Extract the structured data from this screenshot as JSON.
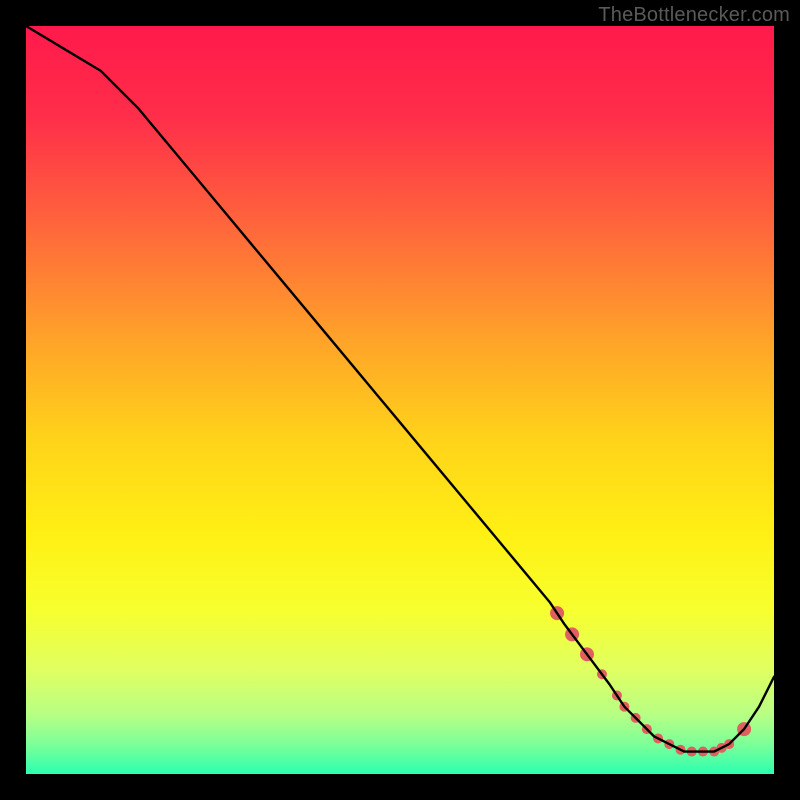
{
  "watermark": "TheBottlenecker.com",
  "chart_data": {
    "type": "line",
    "title": "",
    "xlabel": "",
    "ylabel": "",
    "xlim": [
      0,
      100
    ],
    "ylim": [
      0,
      100
    ],
    "x": [
      0,
      5,
      10,
      15,
      20,
      25,
      30,
      35,
      40,
      45,
      50,
      55,
      60,
      65,
      70,
      72,
      75,
      78,
      80,
      82,
      84,
      86,
      88,
      90,
      92,
      94,
      96,
      98,
      100
    ],
    "values": [
      100,
      97,
      94,
      89,
      83,
      77,
      71,
      65,
      59,
      53,
      47,
      41,
      35,
      29,
      23,
      20,
      16,
      12,
      9,
      7,
      5,
      4,
      3,
      3,
      3,
      4,
      6,
      9,
      13
    ],
    "gradient_stops": [
      {
        "offset": 0.0,
        "color": "#ff1a4b"
      },
      {
        "offset": 0.12,
        "color": "#ff2d4a"
      },
      {
        "offset": 0.28,
        "color": "#ff6b3a"
      },
      {
        "offset": 0.42,
        "color": "#ffa329"
      },
      {
        "offset": 0.55,
        "color": "#ffd21a"
      },
      {
        "offset": 0.68,
        "color": "#fff014"
      },
      {
        "offset": 0.78,
        "color": "#f7ff2e"
      },
      {
        "offset": 0.86,
        "color": "#e0ff60"
      },
      {
        "offset": 0.92,
        "color": "#b8ff84"
      },
      {
        "offset": 0.96,
        "color": "#7dff98"
      },
      {
        "offset": 1.0,
        "color": "#2dffb0"
      }
    ],
    "marker_points_x": [
      71,
      73,
      75,
      77,
      79,
      80,
      81.5,
      83,
      84.5,
      86,
      87.5,
      89,
      90.5,
      92,
      93,
      94,
      96
    ],
    "marker_color": "#e06060",
    "marker_radius_major": 7,
    "marker_radius_minor": 5
  }
}
